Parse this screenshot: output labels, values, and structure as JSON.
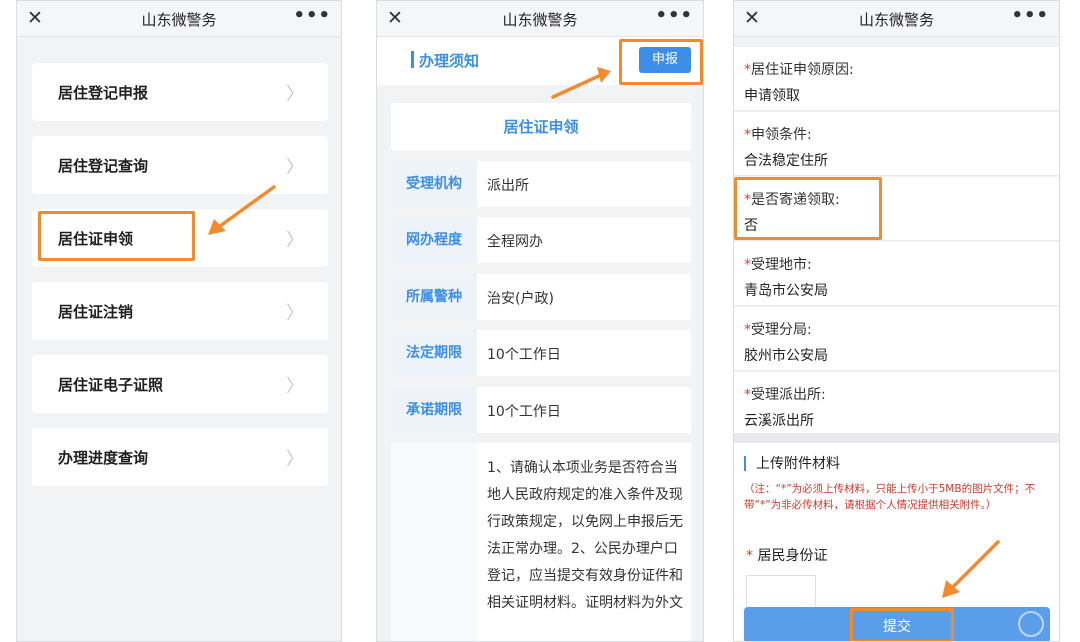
{
  "app_title": "山东微警务",
  "close_symbol": "✕",
  "more_symbol": "•••",
  "chevron_symbol": "〉",
  "accent_color": "#3d8ee6",
  "highlight_color": "#f28a2e",
  "screen1": {
    "menu": [
      {
        "label": "居住登记申报"
      },
      {
        "label": "居住登记查询"
      },
      {
        "label": "居住证申领"
      },
      {
        "label": "居住证注销"
      },
      {
        "label": "居住证电子证照"
      },
      {
        "label": "办理进度查询"
      }
    ],
    "highlighted_item": "居住证申领"
  },
  "screen2": {
    "section_title": "办理须知",
    "report_button": "申报",
    "card_title": "居住证申领",
    "info": [
      {
        "key": "受理机构",
        "value": "派出所"
      },
      {
        "key": "网办程度",
        "value": "全程网办"
      },
      {
        "key": "所属警种",
        "value": "治安(户政)"
      },
      {
        "key": "法定期限",
        "value": "10个工作日"
      },
      {
        "key": "承诺期限",
        "value": "10个工作日"
      }
    ],
    "notes": "1、请确认本项业务是否符合当地人民政府规定的准入条件及现行政策规定，以免网上申报后无法正常办理。2、公民办理户口登记，应当提交有效身份证件和相关证明材料。证明材料为外文"
  },
  "screen3": {
    "fields": [
      {
        "label": "居住证申领原因:",
        "value": "申请领取"
      },
      {
        "label": "申领条件:",
        "value": "合法稳定住所"
      },
      {
        "label": "是否寄递领取:",
        "value": "否"
      },
      {
        "label": "受理地市:",
        "value": "青岛市公安局"
      },
      {
        "label": "受理分局:",
        "value": "胶州市公安局"
      },
      {
        "label": "受理派出所:",
        "value": "云溪派出所"
      }
    ],
    "required_mark": "*",
    "upload_title": "上传附件材料",
    "upload_note": "（注：“*”为必须上传材料，只能上传小于5MB的图片文件；不带“*”为非必传材料，请根据个人情况提供相关附件。）",
    "id_label": "居民身份证",
    "submit_button": "提交"
  }
}
